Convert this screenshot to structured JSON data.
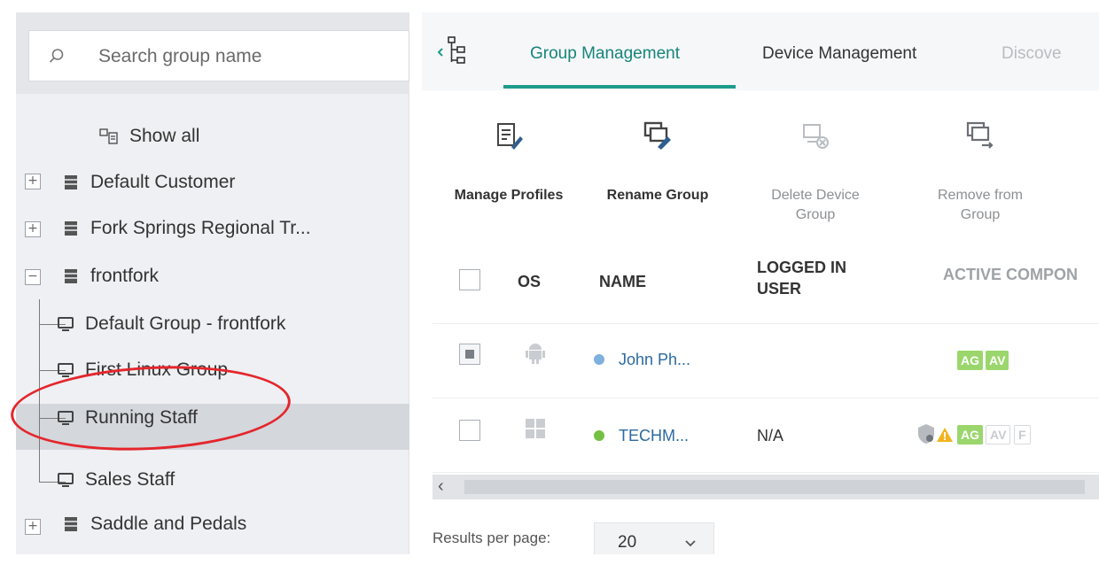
{
  "search": {
    "placeholder": "Search group name"
  },
  "tree": {
    "show_all": "Show all",
    "items": [
      {
        "label": "Default Customer",
        "expander": "+"
      },
      {
        "label": "Fork Springs Regional Tr...",
        "expander": "+"
      },
      {
        "label": "frontfork",
        "expander": "−"
      },
      {
        "label": "Default Group - frontfork"
      },
      {
        "label": "First Linux Group"
      },
      {
        "label": "Running Staff"
      },
      {
        "label": "Sales Staff"
      },
      {
        "label": "Saddle and Pedals",
        "expander": "+"
      }
    ]
  },
  "tabs": [
    {
      "label": "Group Management"
    },
    {
      "label": "Device Management"
    },
    {
      "label": "Discove"
    }
  ],
  "toolbar": {
    "manage_profiles": "Manage Profiles",
    "rename_group": "Rename Group",
    "delete_device_group_1": "Delete Device",
    "delete_device_group_2": "Group",
    "remove_from_group_1": "Remove from",
    "remove_from_group_2": "Group"
  },
  "grid": {
    "headers": {
      "os": "OS",
      "name": "NAME",
      "logged_in_1": "LOGGED IN",
      "logged_in_2": "USER",
      "active_components": "ACTIVE COMPON"
    },
    "rows": [
      {
        "name": "John Ph...",
        "user": "",
        "badges": [
          "AG",
          "AV"
        ],
        "status_color": "#7fb0de"
      },
      {
        "name": "TECHM...",
        "user": "N/A",
        "badges": [
          "AG",
          "AV",
          "F"
        ],
        "status_color": "#74c043"
      }
    ]
  },
  "pager": {
    "label": "Results per page:",
    "value": "20"
  },
  "colors": {
    "accent": "#1c9c8c",
    "selection": "#d4d7dc",
    "highlight": "#e4262c"
  }
}
